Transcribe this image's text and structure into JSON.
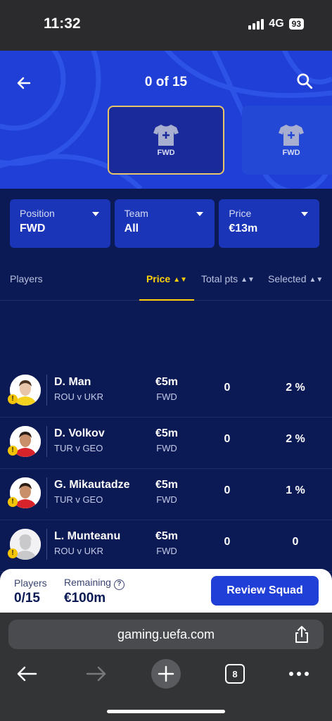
{
  "status_bar": {
    "time": "11:32",
    "network": "4G",
    "battery": "93"
  },
  "header": {
    "counter": "0 of 15",
    "slots": [
      {
        "position": "FWD",
        "selected": true
      },
      {
        "position": "FWD",
        "selected": false
      }
    ]
  },
  "filters": [
    {
      "label": "Position",
      "value": "FWD"
    },
    {
      "label": "Team",
      "value": "All"
    },
    {
      "label": "Price",
      "value": "€13m"
    }
  ],
  "columns": {
    "players": "Players",
    "price": "Price",
    "total_pts": "Total pts",
    "selected": "Selected"
  },
  "players": [
    {
      "name": "D. Man",
      "match": "ROU v UKR",
      "price": "€5m",
      "position": "FWD",
      "points": "0",
      "selected": "2 %",
      "kit": "#f4d21f",
      "skin": "#e8c4a8",
      "hair": "#4a3320"
    },
    {
      "name": "D. Volkov",
      "match": "TUR v GEO",
      "price": "€5m",
      "position": "FWD",
      "points": "0",
      "selected": "2 %",
      "kit": "#d8232a",
      "skin": "#c98f6a",
      "hair": "#2a1d14"
    },
    {
      "name": "G. Mikautadze",
      "match": "TUR v GEO",
      "price": "€5m",
      "position": "FWD",
      "points": "0",
      "selected": "1 %",
      "kit": "#d8232a",
      "skin": "#c98f6a",
      "hair": "#2a1d14"
    },
    {
      "name": "L. Munteanu",
      "match": "ROU v UKR",
      "price": "€5m",
      "position": "FWD",
      "points": "0",
      "selected": "0",
      "kit": "#c9c9cc",
      "skin": "#c9c9cc",
      "hair": "#c9c9cc"
    }
  ],
  "footer": {
    "players_label": "Players",
    "players_value": "0/15",
    "remaining_label": "Remaining",
    "remaining_value": "€100m",
    "review_button": "Review Squad"
  },
  "browser": {
    "url": "gaming.uefa.com",
    "tab_count": "8"
  },
  "colors": {
    "primary": "#1f3fd6",
    "background": "#0b1a55",
    "accent": "#ffd20a"
  }
}
